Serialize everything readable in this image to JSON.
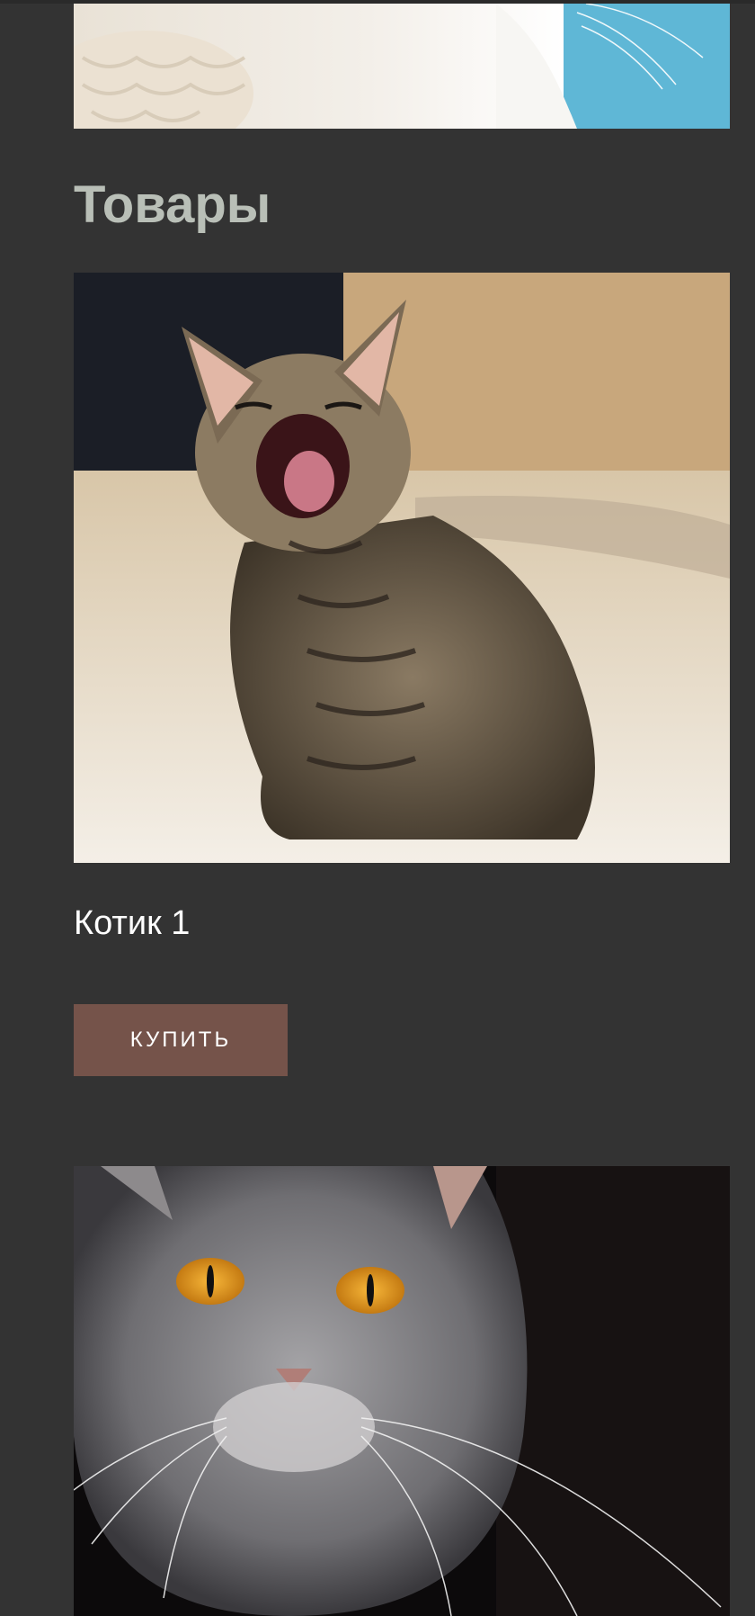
{
  "products": {
    "title": "Товары",
    "items": [
      {
        "name": "Котик 1",
        "buy_label": "Купить",
        "image": "yawning-tabby-kitten-photo"
      },
      {
        "name": "",
        "buy_label": "",
        "image": "grey-cat-amber-eyes-photo"
      }
    ]
  },
  "hero": {
    "image": "white-cat-photo"
  },
  "colors": {
    "background": "#333333",
    "heading": "#b9bfb7",
    "button": "#75534a",
    "text": "#ffffff"
  }
}
